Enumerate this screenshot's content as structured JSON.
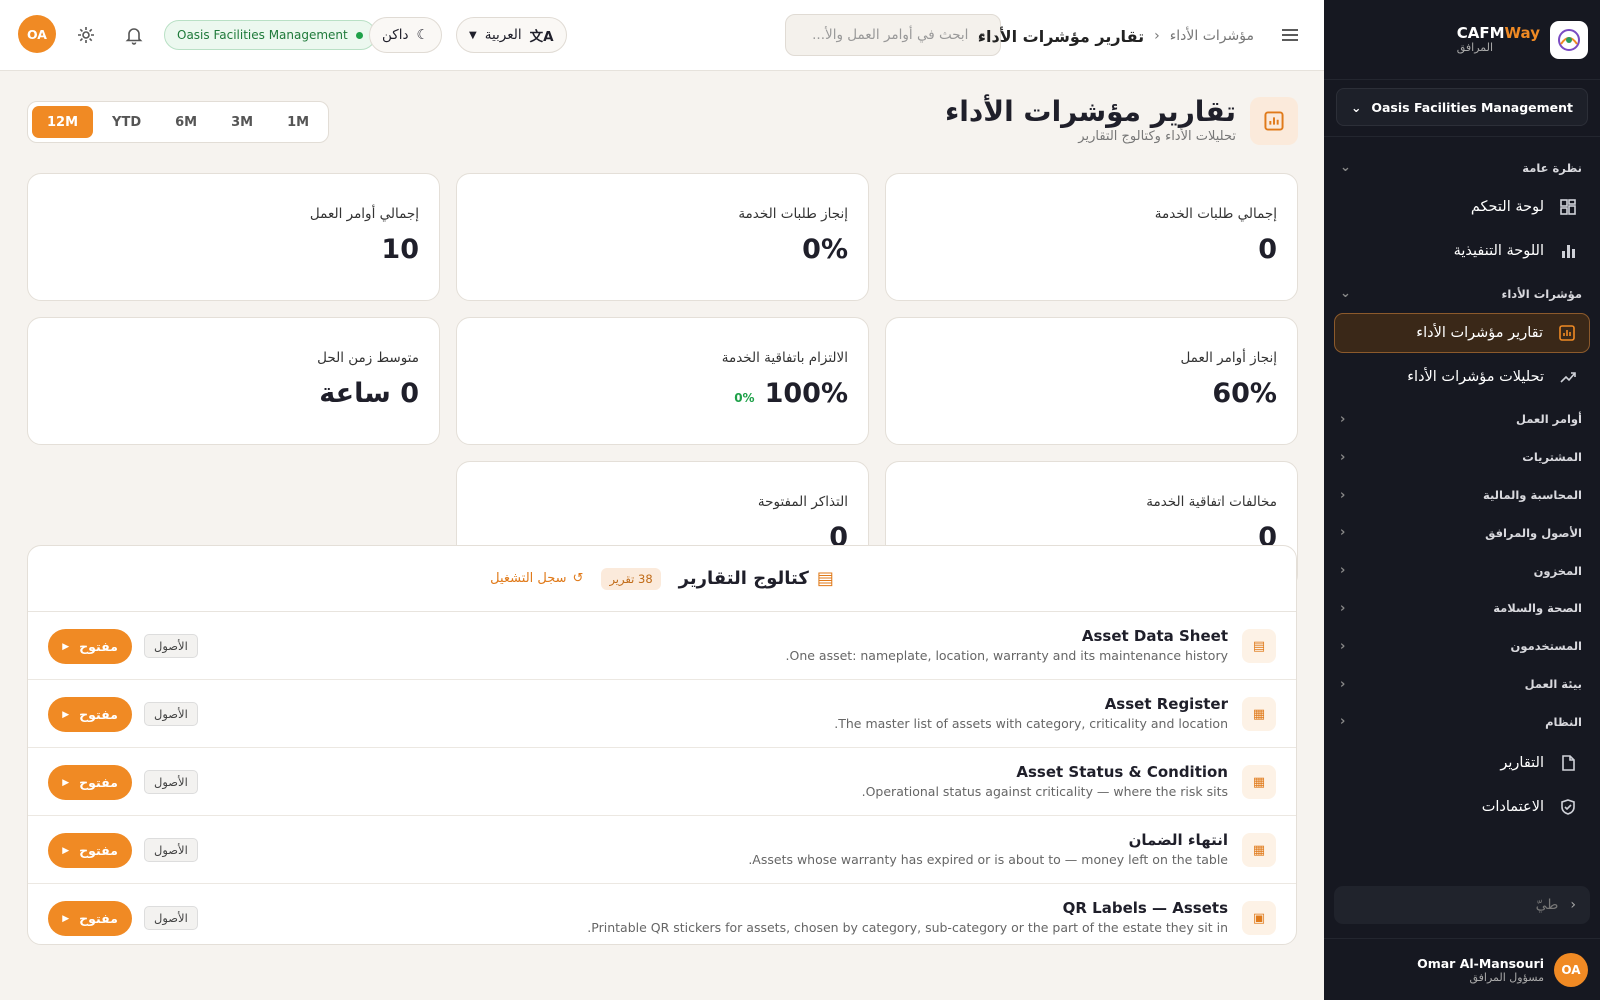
{
  "brand": {
    "name_a": "CAFM",
    "name_b": "Way",
    "sub": "المرافق"
  },
  "org_select": "Oasis Facilities Management",
  "sidebar": {
    "sections": [
      {
        "label": "نظرة عامة",
        "items": [
          {
            "label": "لوحة التحكم",
            "icon": "dashboard-icon"
          },
          {
            "label": "اللوحة التنفيذية",
            "icon": "bar-chart-icon"
          }
        ]
      },
      {
        "label": "مؤشرات الأداء",
        "items": [
          {
            "label": "تقارير مؤشرات الأداء",
            "icon": "report-chart-icon",
            "active": true
          },
          {
            "label": "تحليلات مؤشرات الأداء",
            "icon": "trend-icon"
          }
        ]
      }
    ],
    "collapsed": [
      "أوامر العمل",
      "المشتريات",
      "المحاسبة والمالية",
      "الأصول والمرافق",
      "المخزون",
      "الصحة والسلامة",
      "المستخدمون",
      "بيئة العمل",
      "النظام"
    ],
    "bottom_items": [
      {
        "label": "التقارير",
        "icon": "reports-icon"
      },
      {
        "label": "الاعتمادات",
        "icon": "shield-check-icon"
      }
    ],
    "search_placeholder": "طيّ",
    "user": {
      "initials": "OA",
      "name": "Omar Al-Mansouri",
      "role": "مسؤول المرافق"
    }
  },
  "topbar": {
    "avatar": "OA",
    "org_badge": "Oasis Facilities Management",
    "theme": "داكن",
    "language": "العربية",
    "search_placeholder": "ابحث في أوامر العمل والأ...",
    "breadcrumb_parent": "مؤشرات الأداء",
    "breadcrumb_current": "تقارير مؤشرات الأداء"
  },
  "page": {
    "title": "تقارير مؤشرات الأداء",
    "subtitle": "تحليلات الأداء وكتالوج التقارير"
  },
  "periods": [
    {
      "label": "12M",
      "active": true
    },
    {
      "label": "YTD"
    },
    {
      "label": "6M"
    },
    {
      "label": "3M"
    },
    {
      "label": "1M"
    }
  ],
  "kpis": [
    {
      "label": "إجمالي طلبات الخدمة",
      "value": "0"
    },
    {
      "label": "إنجاز طلبات الخدمة",
      "value": "0%"
    },
    {
      "label": "إجمالي أوامر العمل",
      "value": "10"
    },
    {
      "label": "إنجاز أوامر العمل",
      "value": "60%"
    },
    {
      "label": "الالتزام باتفاقية الخدمة",
      "value": "100%",
      "delta": "0%"
    },
    {
      "label": "متوسط زمن الحل",
      "value": "0 ساعة"
    },
    {
      "label": "مخالفات اتفاقية الخدمة",
      "value": "0"
    },
    {
      "label": "التذاكر المفتوحة",
      "value": "0"
    }
  ],
  "catalog": {
    "title": "كتالوج التقارير",
    "count": "38 تقرير",
    "run_log": "سجل التشغيل",
    "rows": [
      {
        "title": "Asset Data Sheet",
        "desc": "One asset: nameplate, location, warranty and its maintenance history.",
        "tag": "الأصول",
        "action": "مفتوح",
        "icon": "document-icon"
      },
      {
        "title": "Asset Register",
        "desc": "The master list of assets with category, criticality and location.",
        "tag": "الأصول",
        "action": "مفتوح",
        "icon": "table-icon"
      },
      {
        "title": "Asset Status & Condition",
        "desc": "Operational status against criticality — where the risk sits.",
        "tag": "الأصول",
        "action": "مفتوح",
        "icon": "table-icon"
      },
      {
        "title": "انتهاء الضمان",
        "desc": "Assets whose warranty has expired or is about to — money left on the table.",
        "tag": "الأصول",
        "action": "مفتوح",
        "icon": "table-icon"
      },
      {
        "title": "QR Labels — Assets",
        "desc": "Printable QR stickers for assets, chosen by category, sub-category or the part of the estate they sit in.",
        "tag": "الأصول",
        "action": "مفتوح",
        "icon": "qr-icon"
      }
    ]
  }
}
